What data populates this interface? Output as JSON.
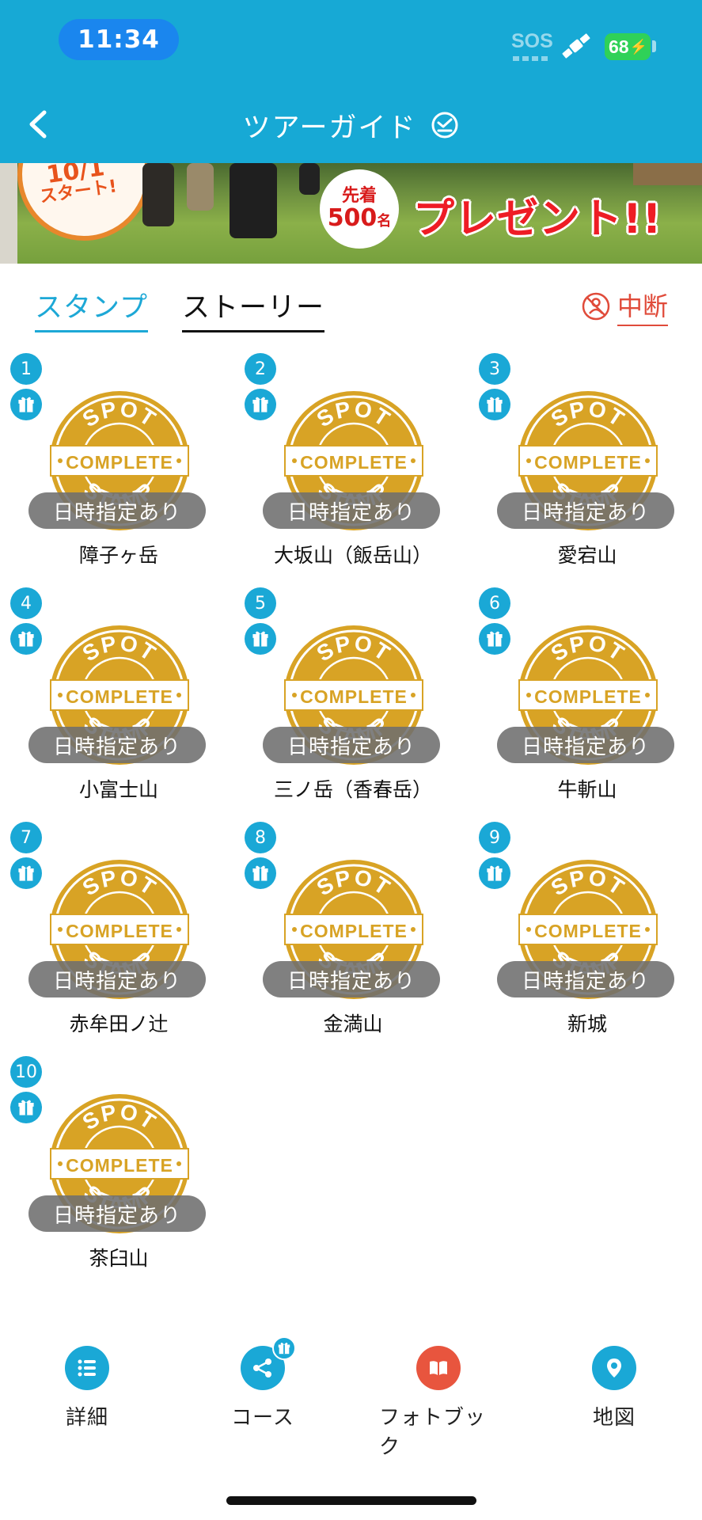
{
  "status_bar": {
    "time": "11:34",
    "sos": "SOS",
    "battery": "68"
  },
  "header": {
    "title": "ツアーガイド"
  },
  "banner": {
    "badge_line1": "10/1",
    "badge_line2": "スタート!",
    "senchaku_line1": "先着",
    "senchaku_count": "500",
    "senchaku_unit": "名",
    "present_text": "プレゼント!!"
  },
  "tabs": [
    {
      "label": "スタンプ",
      "active": true
    },
    {
      "label": "ストーリー",
      "active": false
    }
  ],
  "suspend": {
    "label": "中断"
  },
  "stamp_text": {
    "top": "SPOT",
    "middle": "COMPLETE",
    "bottom": "STAMP"
  },
  "stamps": [
    {
      "number": "1",
      "date_label": "日時指定あり",
      "name": "障子ヶ岳"
    },
    {
      "number": "2",
      "date_label": "日時指定あり",
      "name": "大坂山（飯岳山）"
    },
    {
      "number": "3",
      "date_label": "日時指定あり",
      "name": "愛宕山"
    },
    {
      "number": "4",
      "date_label": "日時指定あり",
      "name": "小富士山"
    },
    {
      "number": "5",
      "date_label": "日時指定あり",
      "name": "三ノ岳（香春岳）"
    },
    {
      "number": "6",
      "date_label": "日時指定あり",
      "name": "牛斬山"
    },
    {
      "number": "7",
      "date_label": "日時指定あり",
      "name": "赤牟田ノ辻"
    },
    {
      "number": "8",
      "date_label": "日時指定あり",
      "name": "金満山"
    },
    {
      "number": "9",
      "date_label": "日時指定あり",
      "name": "新城"
    },
    {
      "number": "10",
      "date_label": "日時指定あり",
      "name": "茶臼山"
    }
  ],
  "bottom_nav": [
    {
      "label": "詳細",
      "icon": "list-icon",
      "color": "#1aa8d6"
    },
    {
      "label": "コース",
      "icon": "share-course-icon",
      "color": "#1aa8d6"
    },
    {
      "label": "フォトブック",
      "icon": "book-icon",
      "color": "#e8553e"
    },
    {
      "label": "地図",
      "icon": "map-pin-icon",
      "color": "#1aa8d6"
    }
  ],
  "colors": {
    "header": "#17a9d5",
    "accent": "#1aa8d6",
    "stamp_gold": "#d8a325",
    "danger": "#e04b3a"
  }
}
